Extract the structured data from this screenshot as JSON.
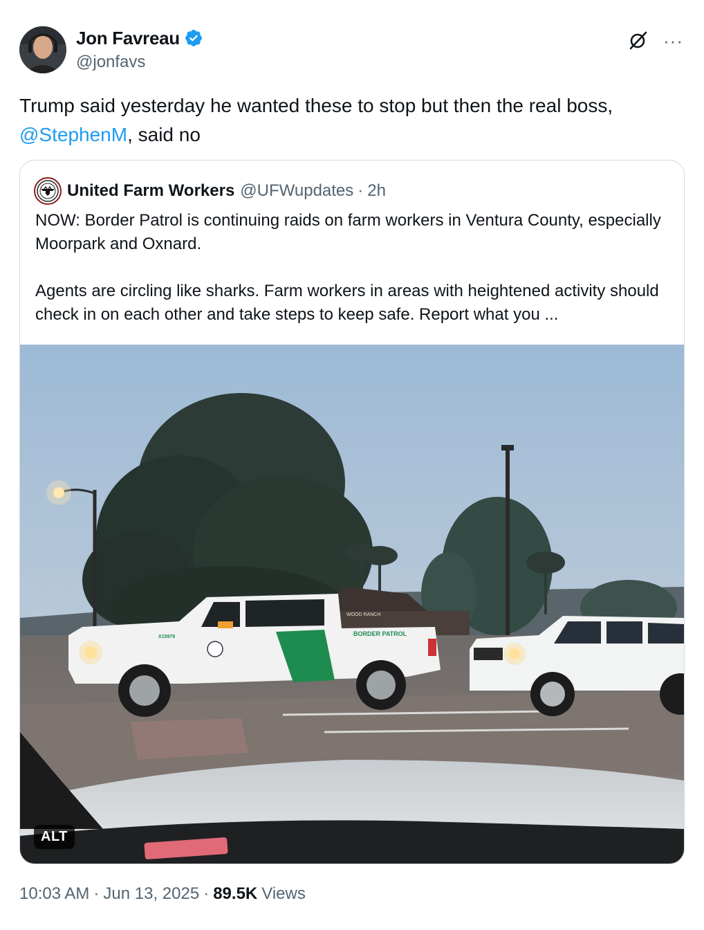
{
  "author": {
    "display_name": "Jon Favreau",
    "handle": "@jonfavs",
    "verified": true,
    "verified_color": "#1d9bf0"
  },
  "actions": {
    "grok_icon": "grok-icon",
    "more_label": "···"
  },
  "tweet": {
    "text_before": "Trump said yesterday he wanted these to stop but then the real boss,",
    "mention": "@StephenM",
    "text_after": ", said no"
  },
  "quote": {
    "display_name": "United Farm Workers",
    "handle": "@UFWupdates",
    "separator": "·",
    "time": "2h",
    "paragraph_1": "NOW: Border Patrol is continuing raids on farm workers in Ventura County, especially Moorpark and Oxnard.",
    "paragraph_2": "Agents are circling like sharks. Farm workers in areas with heightened activity should check in on each other and take steps to keep safe. Report what you ...",
    "image_text": {
      "border_patrol": "BORDER PATROL",
      "wood_ranch": "WOOD RANCH",
      "unit_number": "X15979"
    },
    "alt_label": "ALT"
  },
  "meta": {
    "time": "10:03 AM",
    "date": "Jun 13, 2025",
    "dot": "·",
    "views_count": "89.5K",
    "views_label": "Views"
  },
  "colors": {
    "text_primary": "#0f1419",
    "text_secondary": "#536471",
    "link": "#1d9bf0",
    "border": "#cfd9de",
    "border_patrol_green": "#1e8c4e"
  }
}
